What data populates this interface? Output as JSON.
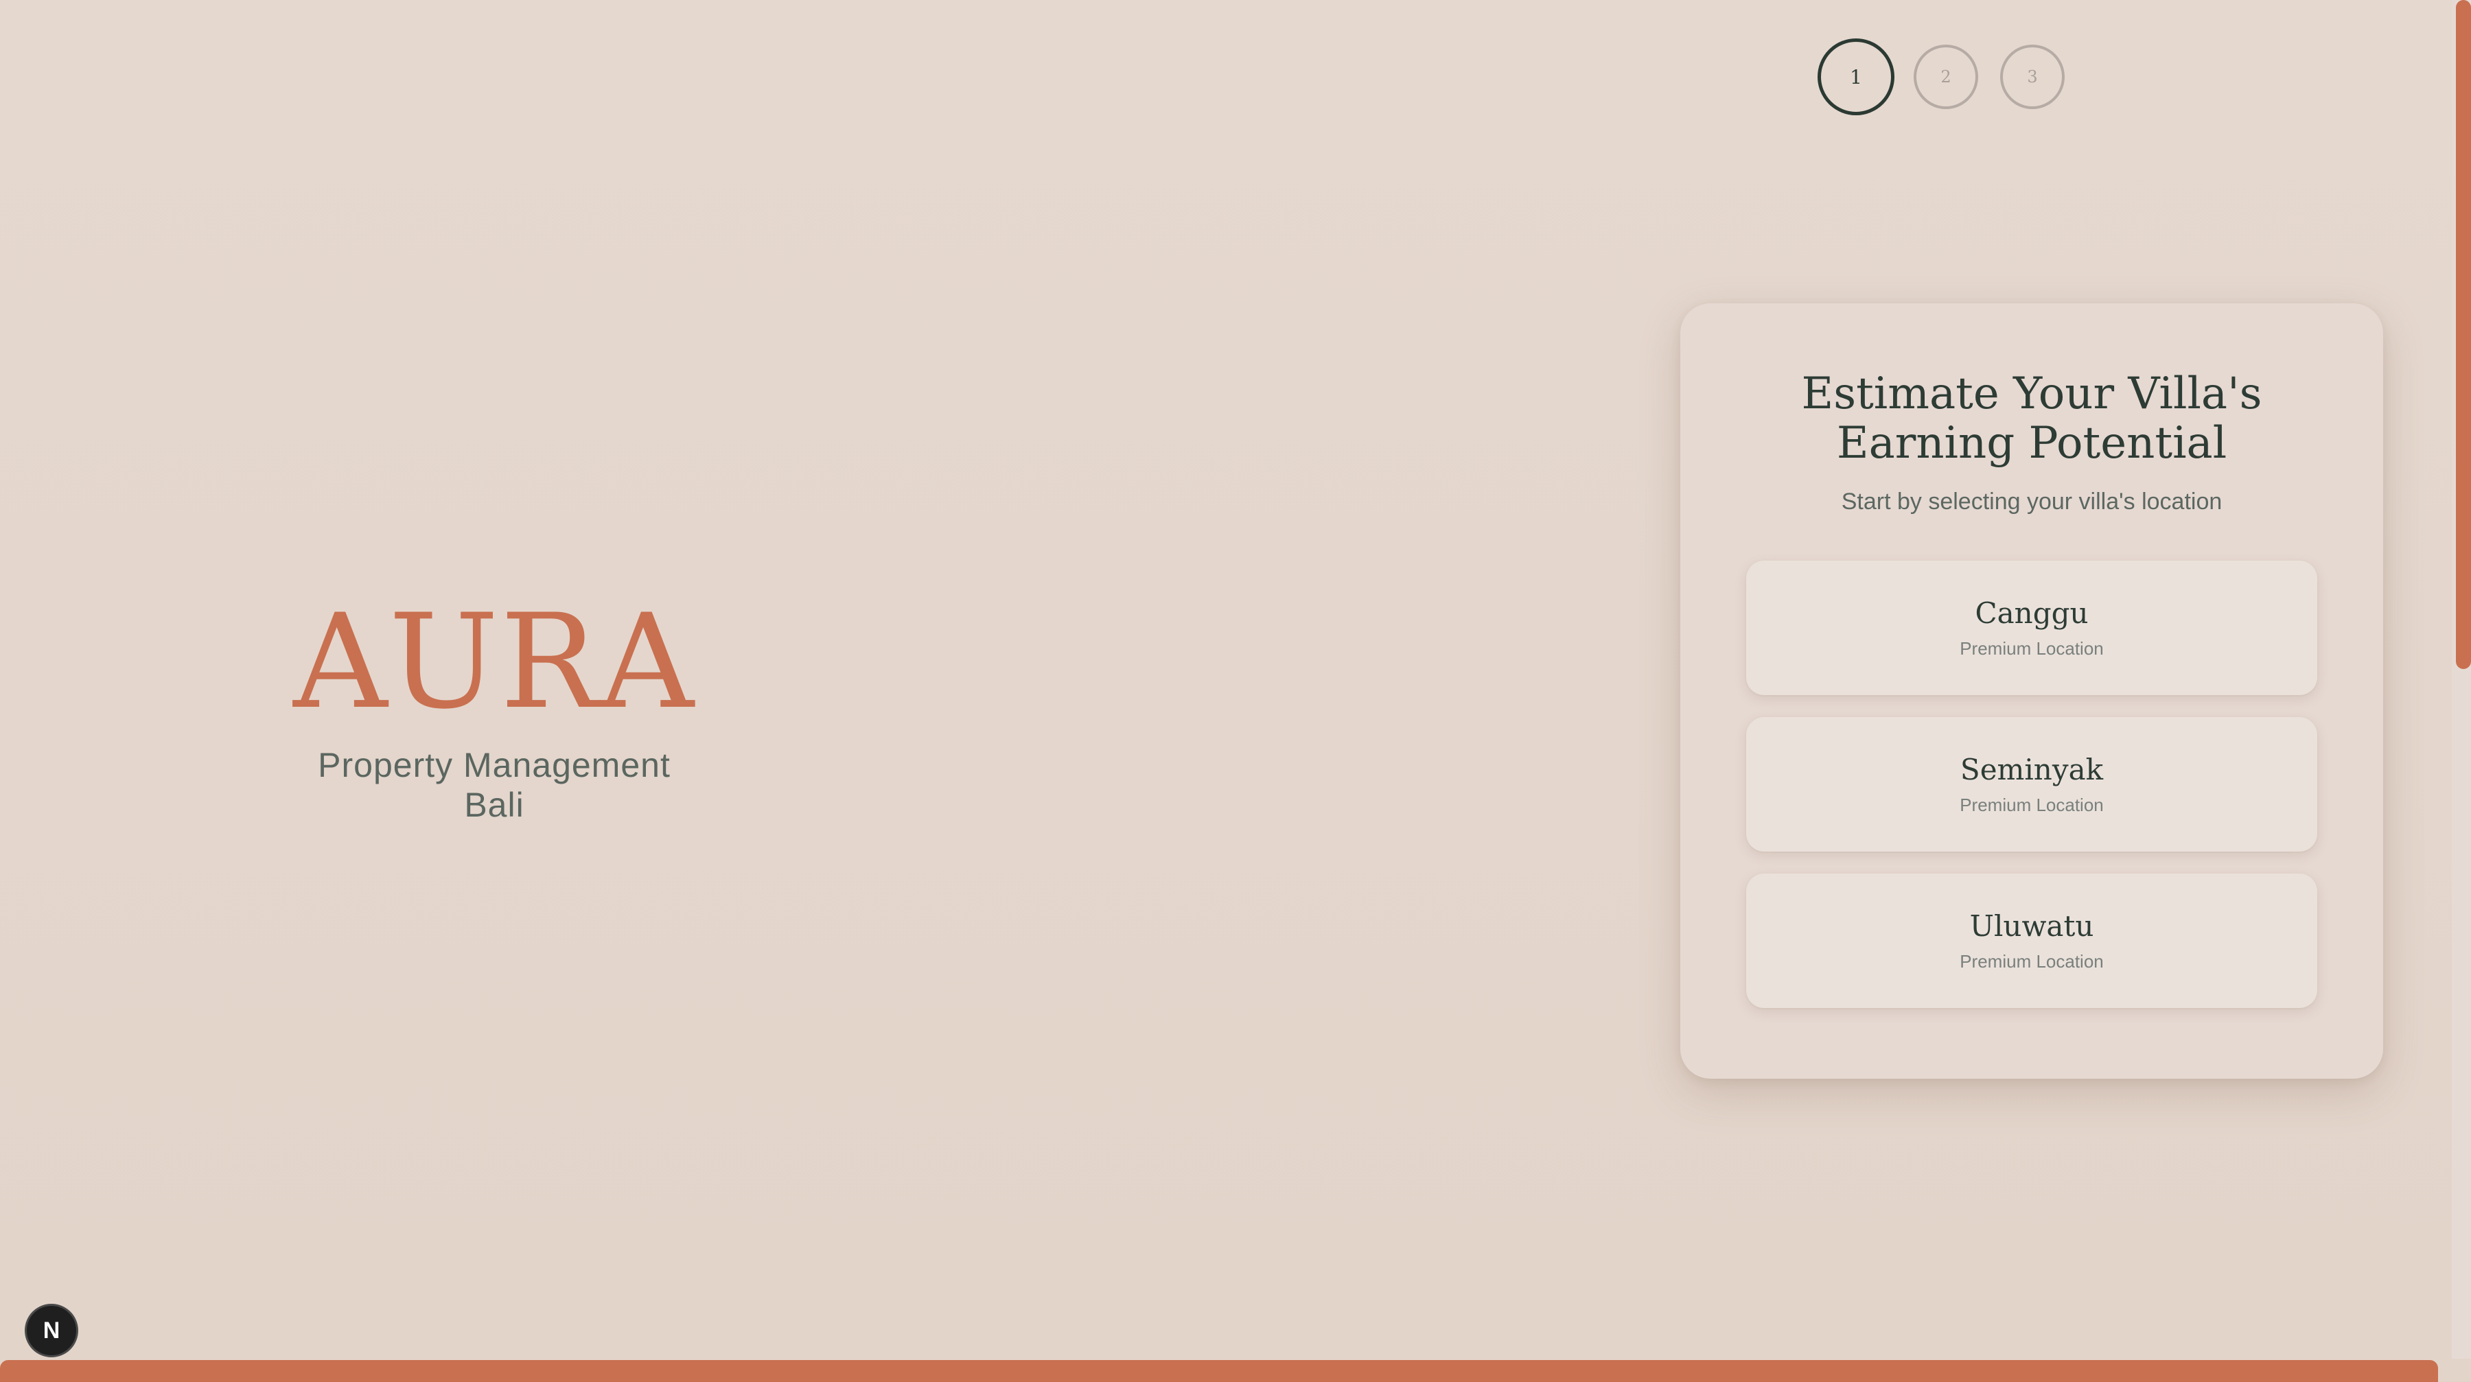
{
  "brand": {
    "logo": "AURA",
    "tagline": "Property Management Bali"
  },
  "steps": [
    {
      "label": "1",
      "state": "active"
    },
    {
      "label": "2",
      "state": "inactive"
    },
    {
      "label": "3",
      "state": "inactive"
    }
  ],
  "card": {
    "title": "Estimate Your Villa's Earning Potential",
    "subtitle": "Start by selecting your villa's location",
    "locations": [
      {
        "name": "Canggu",
        "tag": "Premium Location"
      },
      {
        "name": "Seminyak",
        "tag": "Premium Location"
      },
      {
        "name": "Uluwatu",
        "tag": "Premium Location"
      }
    ]
  },
  "badge": {
    "label": "N",
    "icon": "nextjs-icon"
  },
  "colors": {
    "accent": "#c97050",
    "text_dark": "#2d3c35",
    "background": "#e4d6cd"
  }
}
